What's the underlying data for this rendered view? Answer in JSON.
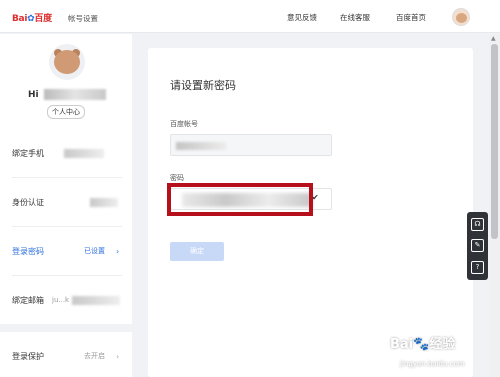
{
  "header": {
    "logo_text_1": "Bai",
    "logo_paw": "✿",
    "logo_text_2": "百度",
    "site_name": "帐号设置",
    "nav": [
      "意见反馈",
      "在线客服",
      "百度首页"
    ]
  },
  "sidebar": {
    "username_prefix": "Hi",
    "center_link": "个人中心",
    "items": [
      {
        "label": "绑定手机",
        "value": ""
      },
      {
        "label": "身份认证",
        "value": ""
      },
      {
        "label": "登录密码",
        "value": "已设置",
        "arrow": "›"
      },
      {
        "label": "绑定邮箱",
        "value": "ju...k"
      },
      {
        "label": "登录保护",
        "value": "去开启",
        "arrow": "›"
      }
    ]
  },
  "main": {
    "title": "请设置新密码",
    "account_label": "百度帐号",
    "password_label": "密码",
    "confirm_button": "确定",
    "check_icon": "✔"
  },
  "tools": [
    "☊",
    "✎",
    "?"
  ],
  "watermark": {
    "main": "Bai🐾经验",
    "sub": "jingyan.baidu.com"
  },
  "colors": {
    "accent": "#2d6fde",
    "brand_red": "#de2d2d",
    "highlight": "#b5101c"
  }
}
